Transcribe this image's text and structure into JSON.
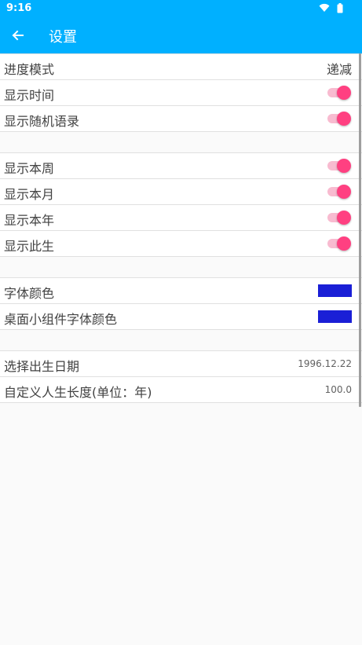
{
  "status_bar": {
    "time": "9:16",
    "icons": [
      "wifi-icon",
      "battery-icon"
    ]
  },
  "toolbar": {
    "title": "设置",
    "back_icon": "arrow-left-icon",
    "color": "#00b0ff"
  },
  "settings": {
    "progress_mode": {
      "label": "进度模式",
      "value": "递减"
    },
    "show_time": {
      "label": "显示时间",
      "on": true
    },
    "show_random_quote": {
      "label": "显示随机语录",
      "on": true
    },
    "show_week": {
      "label": "显示本周",
      "on": true
    },
    "show_month": {
      "label": "显示本月",
      "on": true
    },
    "show_year": {
      "label": "显示本年",
      "on": true
    },
    "show_life": {
      "label": "显示此生",
      "on": true
    },
    "font_color": {
      "label": "字体颜色",
      "color": "#1a1fd6"
    },
    "widget_font_color": {
      "label": "桌面小组件字体颜色",
      "color": "#1a1fd6"
    },
    "birth_date": {
      "label": "选择出生日期",
      "value": "1996.12.22"
    },
    "life_length": {
      "label": "自定义人生长度(单位：年)",
      "value": "100.0"
    }
  },
  "colors": {
    "accent": "#ff4081",
    "accent_track": "#f8bbd0"
  }
}
